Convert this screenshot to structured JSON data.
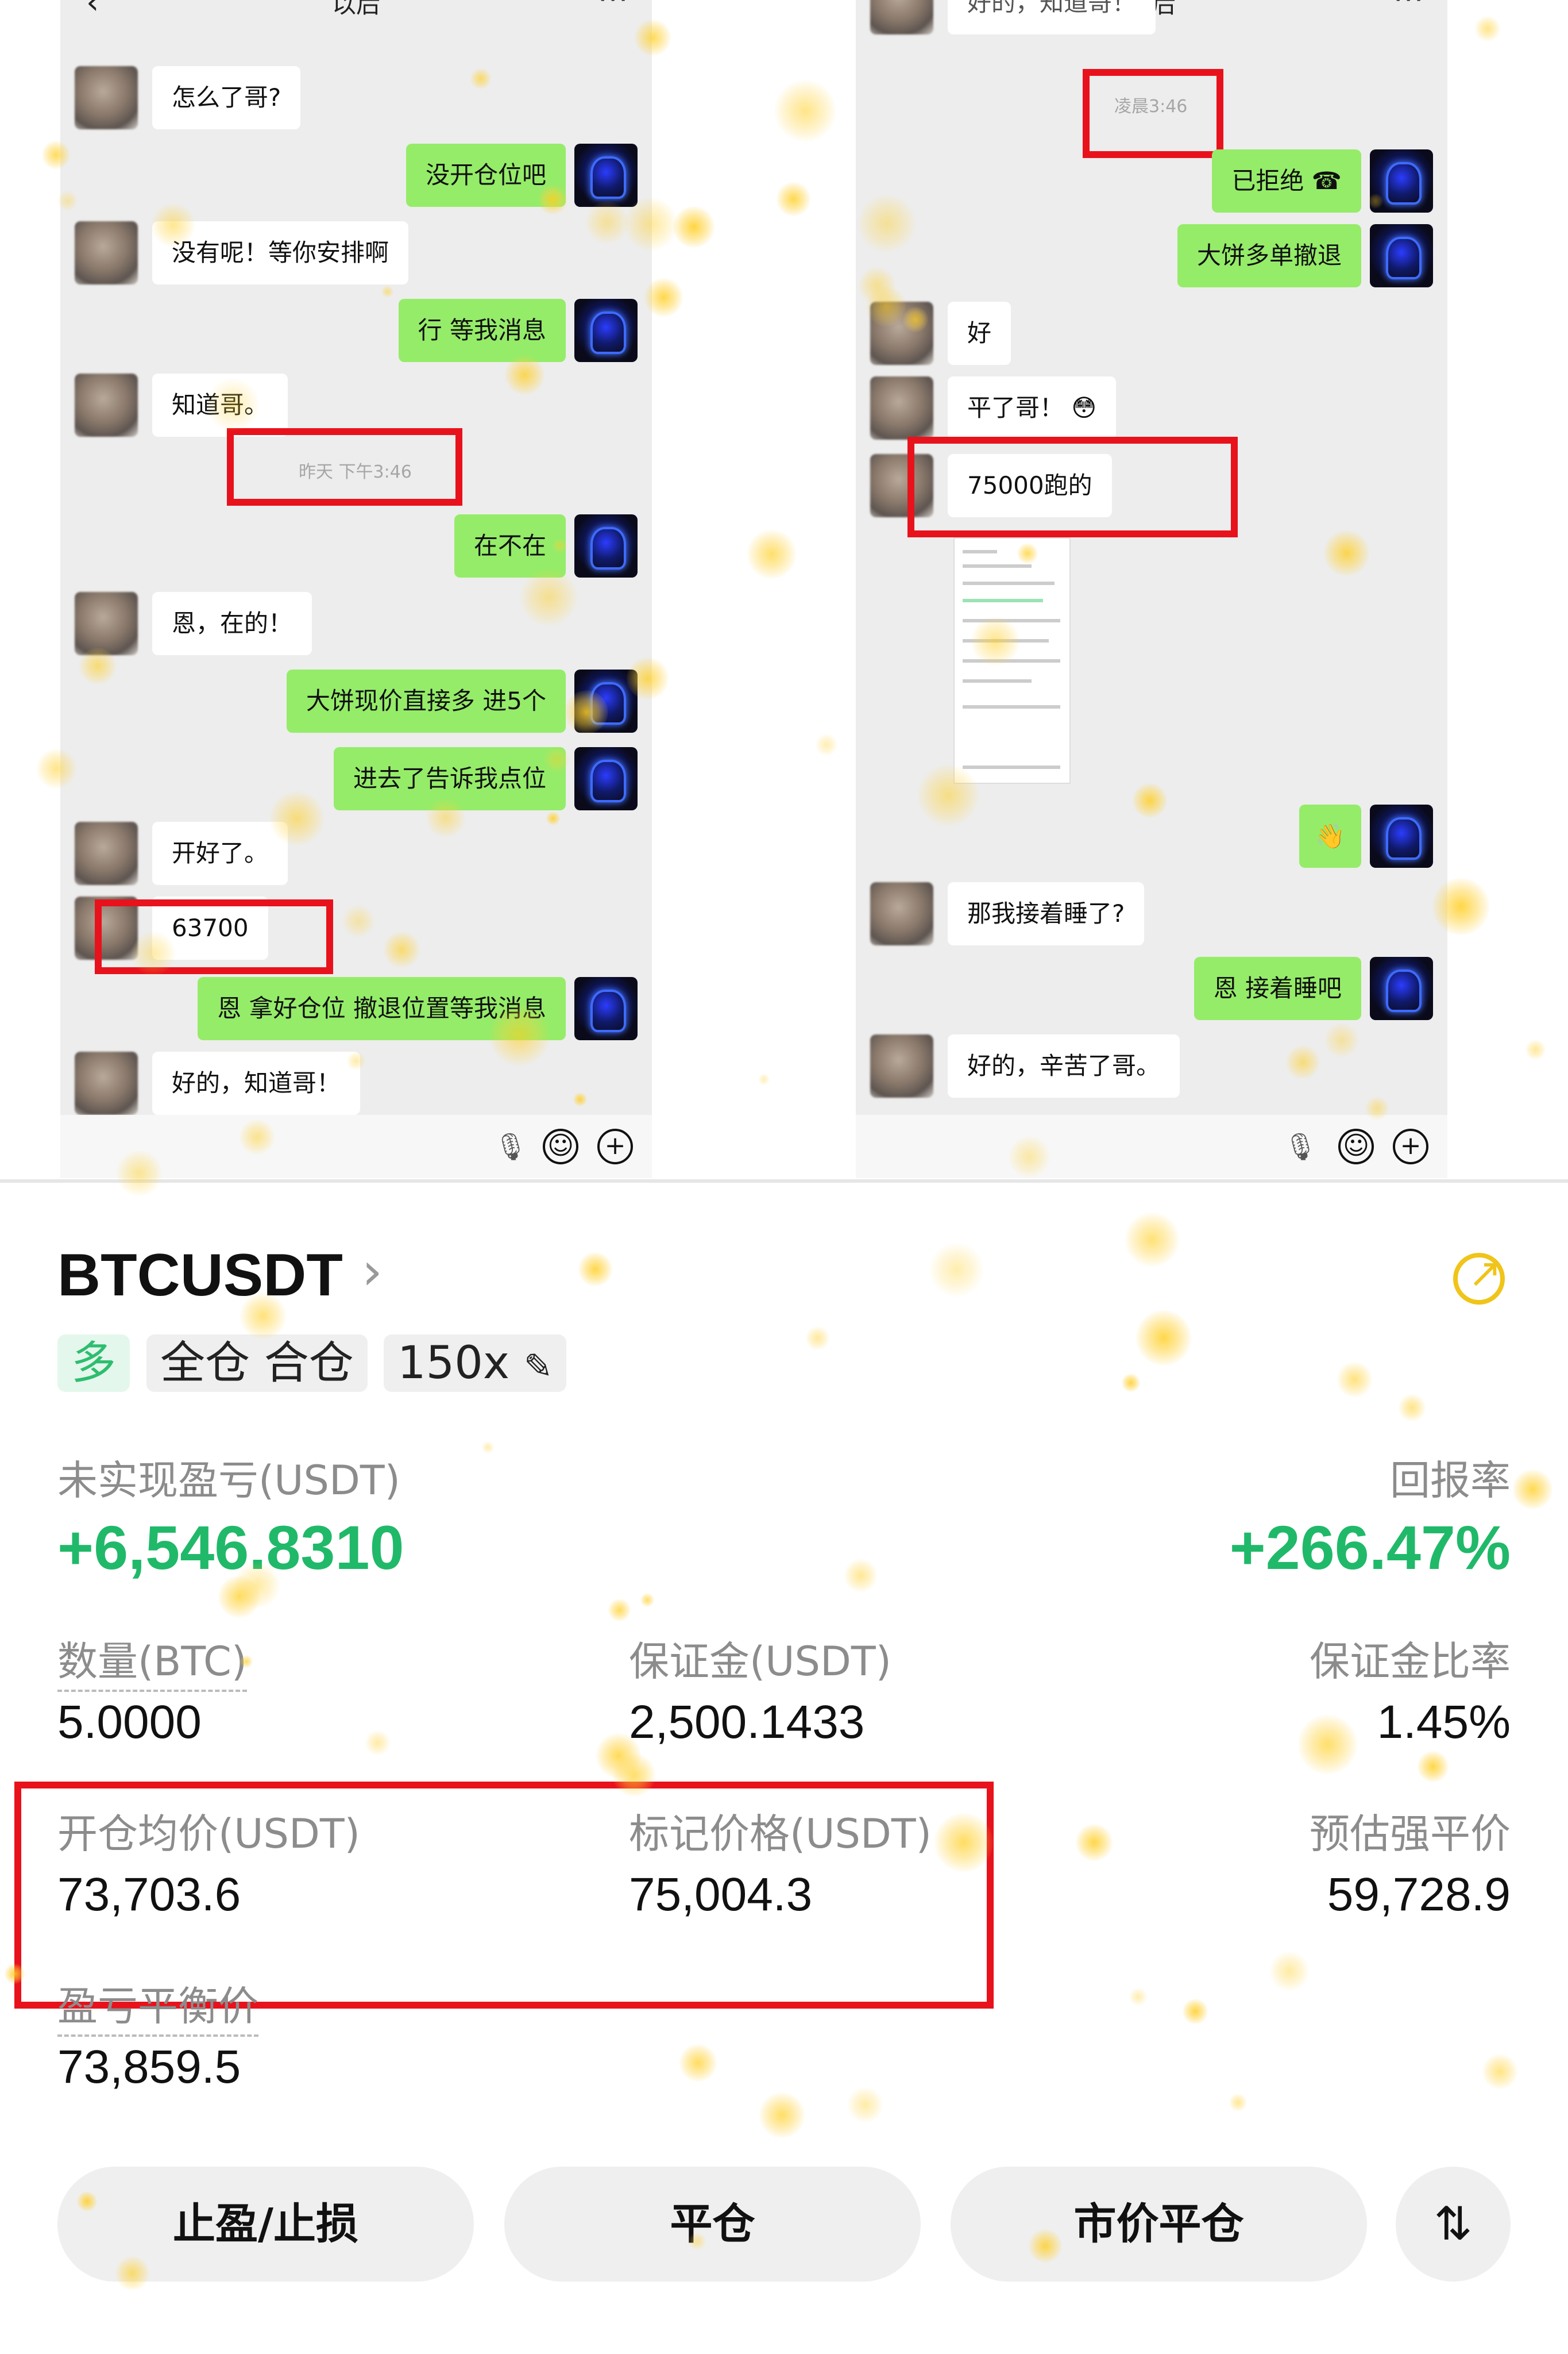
{
  "left_chat": {
    "title": "以后",
    "messages": [
      {
        "side": "in",
        "text": "怎么了哥?"
      },
      {
        "side": "out",
        "text": "没开仓位吧"
      },
      {
        "side": "in",
        "text": "没有呢！等你安排啊"
      },
      {
        "side": "out",
        "text": "行 等我消息"
      },
      {
        "side": "in",
        "text": "知道哥。"
      },
      {
        "side": "time",
        "text": "昨天 下午3:46"
      },
      {
        "side": "out",
        "text": "在不在"
      },
      {
        "side": "in",
        "text": "恩，在的！"
      },
      {
        "side": "out",
        "text": "大饼现价直接多 进5个"
      },
      {
        "side": "out",
        "text": "进去了告诉我点位"
      },
      {
        "side": "in",
        "text": "开好了。"
      },
      {
        "side": "in",
        "text": "63700"
      },
      {
        "side": "out",
        "text": "恩 拿好仓位  撤退位置等我消息"
      },
      {
        "side": "in",
        "text": "好的，知道哥！"
      }
    ]
  },
  "right_chat": {
    "title": "以后",
    "top_partial": "好的，知道哥！",
    "messages": [
      {
        "side": "time",
        "text": "凌晨3:46"
      },
      {
        "side": "out",
        "text": "已拒绝 ☎"
      },
      {
        "side": "out",
        "text": "大饼多单撤退"
      },
      {
        "side": "in",
        "text": "好"
      },
      {
        "side": "in",
        "text": "平了哥！ 😳"
      },
      {
        "side": "in",
        "text": "75000跑的"
      },
      {
        "side": "out",
        "text": "👋"
      },
      {
        "side": "in",
        "text": "那我接着睡了?"
      },
      {
        "side": "out",
        "text": "恩 接着睡吧"
      },
      {
        "side": "in",
        "text": "好的，辛苦了哥。"
      }
    ]
  },
  "trade": {
    "symbol": "BTCUSDT",
    "tags": {
      "direction": "多",
      "margin_mode": "全仓 合仓",
      "leverage": "150x"
    },
    "unrealized_pnl_label": "未实现盈亏(USDT)",
    "unrealized_pnl": "+6,546.8310",
    "roe_label": "回报率",
    "roe": "+266.47%",
    "qty_label": "数量(BTC)",
    "qty": "5.0000",
    "margin_label": "保证金(USDT)",
    "margin": "2,500.1433",
    "margin_ratio_label": "保证金比率",
    "margin_ratio": "1.45%",
    "entry_label": "开仓均价(USDT)",
    "entry": "73,703.6",
    "mark_label": "标记价格(USDT)",
    "mark": "75,004.3",
    "liq_label": "预估强平价",
    "liq": "59,728.9",
    "breakeven_label": "盈亏平衡价",
    "breakeven": "73,859.5",
    "buttons": {
      "tpsl": "止盈/止损",
      "close": "平仓",
      "market_close": "市价平仓",
      "swap": "⇅"
    }
  }
}
